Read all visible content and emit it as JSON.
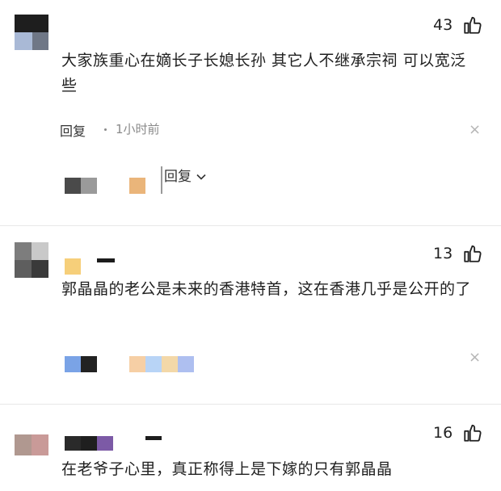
{
  "comments": [
    {
      "likes": "43",
      "text": "大家族重心在嫡长子长媳长孙 其它人不继承宗祠 可以宽泛些",
      "reply_label": "回复",
      "time": "1小时前",
      "view_replies": "回复"
    },
    {
      "likes": "13",
      "text": "郭晶晶的老公是未来的香港特首，这在香港几乎是公开的了"
    },
    {
      "likes": "16",
      "text": "在老爷子心里，真正称得上是下嫁的只有郭晶晶"
    }
  ],
  "icons": {
    "like": "thumbs-up-icon",
    "close": "close-icon",
    "chevron": "chevron-down-icon"
  },
  "colors": {
    "text": "#1f1f1f",
    "muted": "#8a8a8a",
    "close": "#b5b5b5",
    "divider": "#e8e8e8"
  }
}
